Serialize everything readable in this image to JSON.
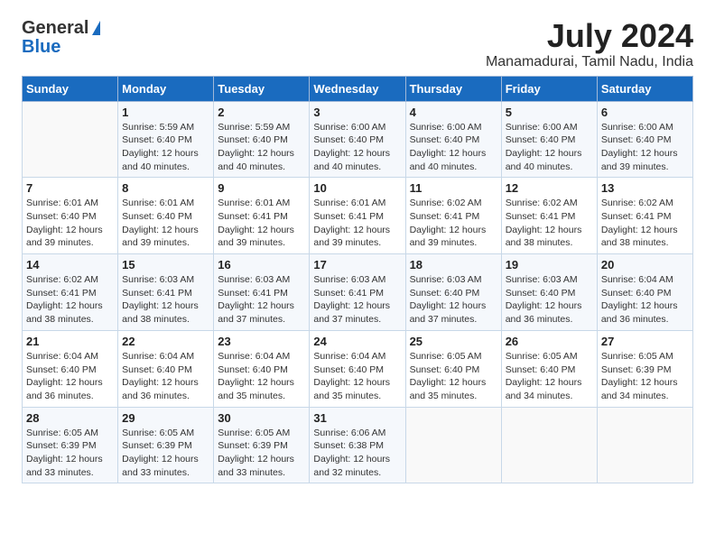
{
  "header": {
    "logo_general": "General",
    "logo_blue": "Blue",
    "month": "July 2024",
    "location": "Manamadurai, Tamil Nadu, India"
  },
  "days_of_week": [
    "Sunday",
    "Monday",
    "Tuesday",
    "Wednesday",
    "Thursday",
    "Friday",
    "Saturday"
  ],
  "weeks": [
    [
      {
        "day": "",
        "info": ""
      },
      {
        "day": "1",
        "info": "Sunrise: 5:59 AM\nSunset: 6:40 PM\nDaylight: 12 hours\nand 40 minutes."
      },
      {
        "day": "2",
        "info": "Sunrise: 5:59 AM\nSunset: 6:40 PM\nDaylight: 12 hours\nand 40 minutes."
      },
      {
        "day": "3",
        "info": "Sunrise: 6:00 AM\nSunset: 6:40 PM\nDaylight: 12 hours\nand 40 minutes."
      },
      {
        "day": "4",
        "info": "Sunrise: 6:00 AM\nSunset: 6:40 PM\nDaylight: 12 hours\nand 40 minutes."
      },
      {
        "day": "5",
        "info": "Sunrise: 6:00 AM\nSunset: 6:40 PM\nDaylight: 12 hours\nand 40 minutes."
      },
      {
        "day": "6",
        "info": "Sunrise: 6:00 AM\nSunset: 6:40 PM\nDaylight: 12 hours\nand 39 minutes."
      }
    ],
    [
      {
        "day": "7",
        "info": "Sunrise: 6:01 AM\nSunset: 6:40 PM\nDaylight: 12 hours\nand 39 minutes."
      },
      {
        "day": "8",
        "info": "Sunrise: 6:01 AM\nSunset: 6:40 PM\nDaylight: 12 hours\nand 39 minutes."
      },
      {
        "day": "9",
        "info": "Sunrise: 6:01 AM\nSunset: 6:41 PM\nDaylight: 12 hours\nand 39 minutes."
      },
      {
        "day": "10",
        "info": "Sunrise: 6:01 AM\nSunset: 6:41 PM\nDaylight: 12 hours\nand 39 minutes."
      },
      {
        "day": "11",
        "info": "Sunrise: 6:02 AM\nSunset: 6:41 PM\nDaylight: 12 hours\nand 39 minutes."
      },
      {
        "day": "12",
        "info": "Sunrise: 6:02 AM\nSunset: 6:41 PM\nDaylight: 12 hours\nand 38 minutes."
      },
      {
        "day": "13",
        "info": "Sunrise: 6:02 AM\nSunset: 6:41 PM\nDaylight: 12 hours\nand 38 minutes."
      }
    ],
    [
      {
        "day": "14",
        "info": "Sunrise: 6:02 AM\nSunset: 6:41 PM\nDaylight: 12 hours\nand 38 minutes."
      },
      {
        "day": "15",
        "info": "Sunrise: 6:03 AM\nSunset: 6:41 PM\nDaylight: 12 hours\nand 38 minutes."
      },
      {
        "day": "16",
        "info": "Sunrise: 6:03 AM\nSunset: 6:41 PM\nDaylight: 12 hours\nand 37 minutes."
      },
      {
        "day": "17",
        "info": "Sunrise: 6:03 AM\nSunset: 6:41 PM\nDaylight: 12 hours\nand 37 minutes."
      },
      {
        "day": "18",
        "info": "Sunrise: 6:03 AM\nSunset: 6:40 PM\nDaylight: 12 hours\nand 37 minutes."
      },
      {
        "day": "19",
        "info": "Sunrise: 6:03 AM\nSunset: 6:40 PM\nDaylight: 12 hours\nand 36 minutes."
      },
      {
        "day": "20",
        "info": "Sunrise: 6:04 AM\nSunset: 6:40 PM\nDaylight: 12 hours\nand 36 minutes."
      }
    ],
    [
      {
        "day": "21",
        "info": "Sunrise: 6:04 AM\nSunset: 6:40 PM\nDaylight: 12 hours\nand 36 minutes."
      },
      {
        "day": "22",
        "info": "Sunrise: 6:04 AM\nSunset: 6:40 PM\nDaylight: 12 hours\nand 36 minutes."
      },
      {
        "day": "23",
        "info": "Sunrise: 6:04 AM\nSunset: 6:40 PM\nDaylight: 12 hours\nand 35 minutes."
      },
      {
        "day": "24",
        "info": "Sunrise: 6:04 AM\nSunset: 6:40 PM\nDaylight: 12 hours\nand 35 minutes."
      },
      {
        "day": "25",
        "info": "Sunrise: 6:05 AM\nSunset: 6:40 PM\nDaylight: 12 hours\nand 35 minutes."
      },
      {
        "day": "26",
        "info": "Sunrise: 6:05 AM\nSunset: 6:40 PM\nDaylight: 12 hours\nand 34 minutes."
      },
      {
        "day": "27",
        "info": "Sunrise: 6:05 AM\nSunset: 6:39 PM\nDaylight: 12 hours\nand 34 minutes."
      }
    ],
    [
      {
        "day": "28",
        "info": "Sunrise: 6:05 AM\nSunset: 6:39 PM\nDaylight: 12 hours\nand 33 minutes."
      },
      {
        "day": "29",
        "info": "Sunrise: 6:05 AM\nSunset: 6:39 PM\nDaylight: 12 hours\nand 33 minutes."
      },
      {
        "day": "30",
        "info": "Sunrise: 6:05 AM\nSunset: 6:39 PM\nDaylight: 12 hours\nand 33 minutes."
      },
      {
        "day": "31",
        "info": "Sunrise: 6:06 AM\nSunset: 6:38 PM\nDaylight: 12 hours\nand 32 minutes."
      },
      {
        "day": "",
        "info": ""
      },
      {
        "day": "",
        "info": ""
      },
      {
        "day": "",
        "info": ""
      }
    ]
  ]
}
